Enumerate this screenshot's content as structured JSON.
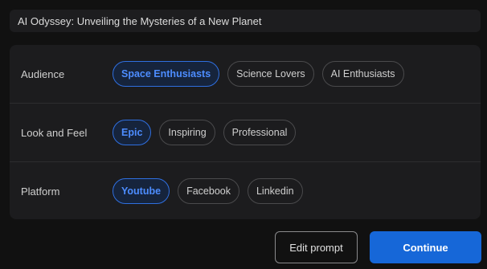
{
  "header": {
    "title": "AI Odyssey: Unveiling the Mysteries of a New Planet"
  },
  "sections": [
    {
      "label": "Audience",
      "options": [
        "Space Enthusiasts",
        "Science Lovers",
        "AI Enthusiasts"
      ],
      "selected": "Space Enthusiasts"
    },
    {
      "label": "Look and Feel",
      "options": [
        "Epic",
        "Inspiring",
        "Professional"
      ],
      "selected": "Epic"
    },
    {
      "label": "Platform",
      "options": [
        "Youtube",
        "Facebook",
        "Linkedin"
      ],
      "selected": "Youtube"
    }
  ],
  "actions": {
    "edit_label": "Edit prompt",
    "continue_label": "Continue"
  },
  "colors": {
    "accent": "#1667d8",
    "selected_text": "#4d8dff",
    "background": "#111111",
    "panel": "#1c1c1e"
  }
}
